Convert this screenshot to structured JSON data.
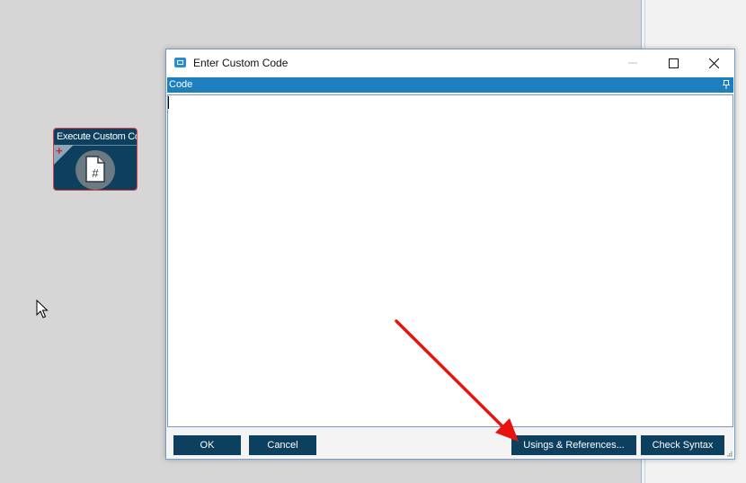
{
  "node": {
    "title": "Execute Custom Code",
    "plus": "+",
    "icon": "hash-file-icon"
  },
  "dialog": {
    "title": "Enter Custom Code",
    "section_header": "Code",
    "code_value": "",
    "buttons": {
      "ok": "OK",
      "cancel": "Cancel",
      "usings": "Usings & References...",
      "check_syntax": "Check Syntax"
    },
    "icons": [
      "app-window-icon",
      "minimize-icon",
      "maximize-icon",
      "close-icon",
      "pin-icon",
      "resize-grip-icon"
    ]
  },
  "annotation": {
    "icon": "red-arrow-icon",
    "color": "#e8130f"
  },
  "colors": {
    "accent_header": "#1e7fbf",
    "button_bg": "#0d3f5e",
    "node_border": "#e04040"
  }
}
